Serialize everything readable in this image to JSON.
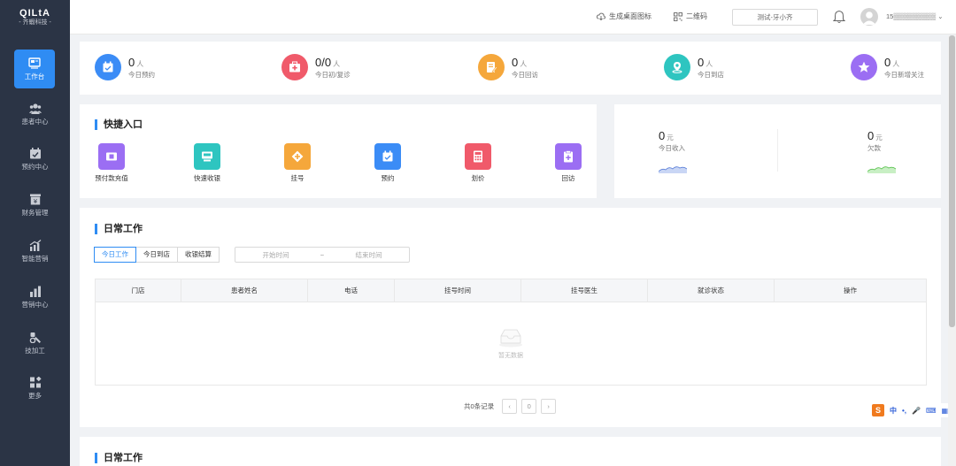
{
  "sidebar": {
    "logo_mark": "QILtA",
    "logo_sub": "- 齐蝦科技 -",
    "items": [
      {
        "label": "工作台",
        "icon": "workbench-icon"
      },
      {
        "label": "患者中心",
        "icon": "patients-icon"
      },
      {
        "label": "预约中心",
        "icon": "calendar-icon"
      },
      {
        "label": "财务管理",
        "icon": "finance-icon"
      },
      {
        "label": "智能营销",
        "icon": "marketing-icon"
      },
      {
        "label": "营销中心",
        "icon": "bar-chart-icon"
      },
      {
        "label": "技加工",
        "icon": "tools-icon"
      },
      {
        "label": "更多",
        "icon": "grid-icon"
      }
    ]
  },
  "header": {
    "desktop_link": "生成桌面图标",
    "qrcode_link": "二维码",
    "store": "测试-牙小齐",
    "user": "15▒▒▒▒▒▒▒▒▒"
  },
  "stats": [
    {
      "value": "0",
      "unit": "人",
      "label": "今日预约",
      "color": "#3b8cf6",
      "icon": "appointment-icon"
    },
    {
      "value": "0/0",
      "unit": "人",
      "label": "今日初/复诊",
      "color": "#f05a6a",
      "icon": "medical-kit-icon"
    },
    {
      "value": "0",
      "unit": "人",
      "label": "今日回访",
      "color": "#f5a73b",
      "icon": "followup-icon"
    },
    {
      "value": "0",
      "unit": "人",
      "label": "今日到店",
      "color": "#2ec5c0",
      "icon": "location-icon"
    },
    {
      "value": "0",
      "unit": "人",
      "label": "今日新增关注",
      "color": "#9b6ef3",
      "icon": "star-icon"
    }
  ],
  "quick": {
    "title": "快捷入口",
    "items": [
      {
        "label": "预付款充值",
        "color": "#9b6ef3",
        "icon": "prepay-icon"
      },
      {
        "label": "快速收银",
        "color": "#2ec5c0",
        "icon": "cashier-icon"
      },
      {
        "label": "挂号",
        "color": "#f5a73b",
        "icon": "register-icon"
      },
      {
        "label": "预约",
        "color": "#3b8cf6",
        "icon": "appointment-icon"
      },
      {
        "label": "划价",
        "color": "#f05a6a",
        "icon": "calculator-icon"
      },
      {
        "label": "回访",
        "color": "#9b6ef3",
        "icon": "followup-icon"
      }
    ]
  },
  "income": {
    "today": {
      "value": "0",
      "unit": "元",
      "label": "今日收入"
    },
    "debt": {
      "value": "0",
      "unit": "元",
      "label": "欠款"
    }
  },
  "daily": {
    "title": "日常工作",
    "tabs": [
      "今日工作",
      "今日到店",
      "收银结算"
    ],
    "range_start": "开始时间",
    "range_sep": "~",
    "range_end": "结束时间",
    "columns": [
      "门店",
      "患者姓名",
      "电话",
      "挂号时间",
      "挂号医生",
      "就诊状态",
      "操作"
    ],
    "empty": "暂无数据",
    "total": "共0条记录",
    "page": "0"
  },
  "daily2": {
    "title": "日常工作"
  },
  "ime": {
    "logo": "S",
    "items": [
      "中",
      "•,",
      "🎤",
      "⌨",
      "▦"
    ]
  }
}
